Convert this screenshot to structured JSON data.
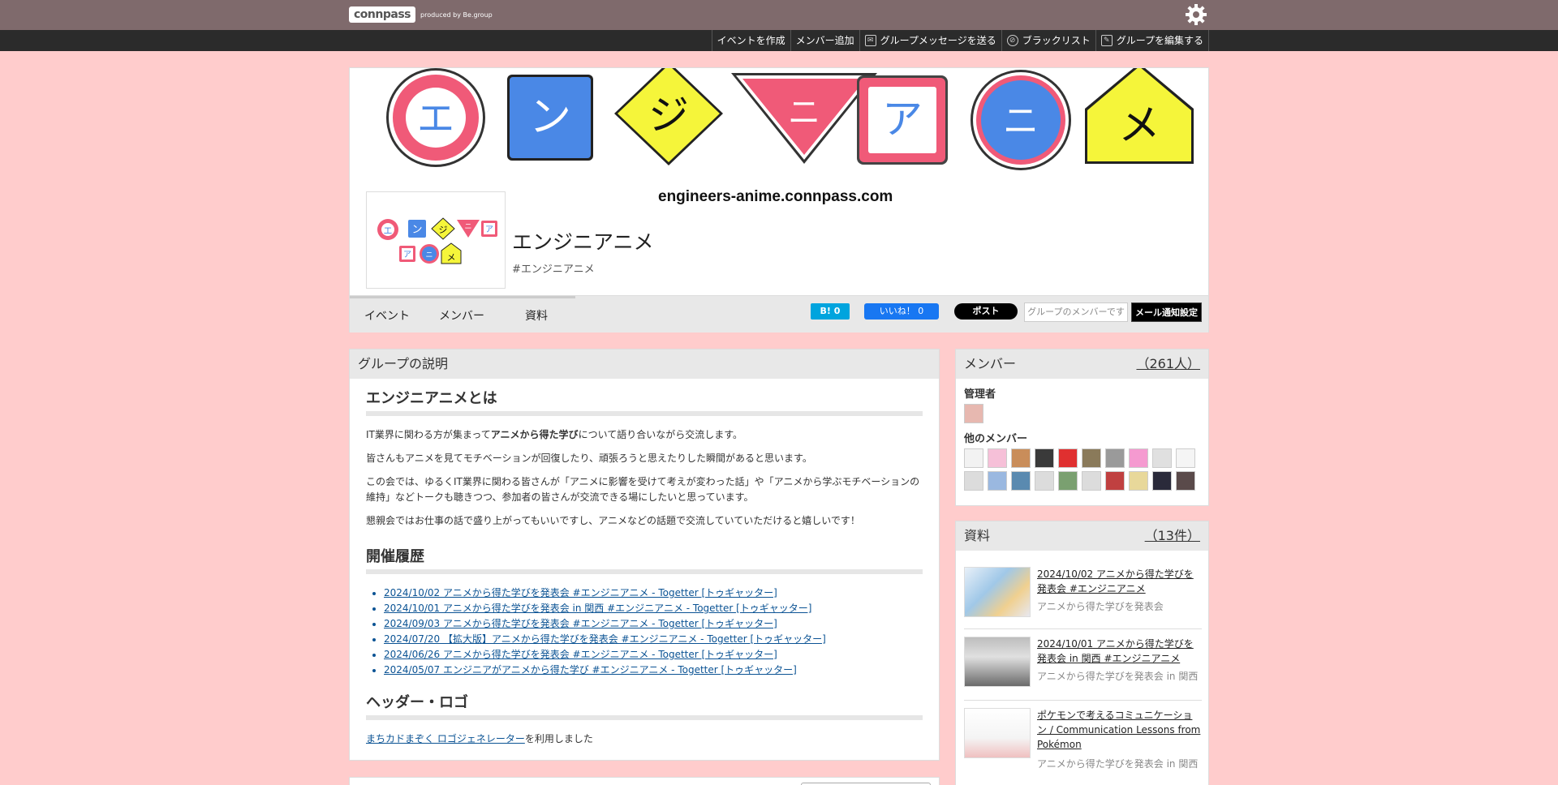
{
  "topbar": {
    "logo_text": "connpass",
    "logo_sub": "produced by Be.group"
  },
  "subnav": [
    {
      "label": "イベントを作成",
      "icon": ""
    },
    {
      "label": "メンバー追加",
      "icon": ""
    },
    {
      "label": "グループメッセージを送る",
      "icon": "mail-icon"
    },
    {
      "label": "ブラックリスト",
      "icon": "block-icon"
    },
    {
      "label": "グループを編集する",
      "icon": "edit-icon"
    }
  ],
  "banner": {
    "signs": [
      "エ",
      "ン",
      "ジ",
      "ニ",
      "ア",
      "ニ",
      "メ"
    ],
    "domain": "engineers-anime.connpass.com"
  },
  "group": {
    "title": "エンジニアニメ",
    "tag": "#エンジニアニメ"
  },
  "tabs": [
    "イベント",
    "メンバー",
    "資料"
  ],
  "social": {
    "hatena": "B! 0",
    "facebook": "いいね！ 0",
    "x": "ポスト",
    "member_status": "グループのメンバーです",
    "mail_setting": "メール通知設定"
  },
  "colors": {
    "page_bg": "#ffcccc",
    "topbar": "#7f6a6c",
    "sign_pink": "#f05a78",
    "sign_blue": "#4a88e6",
    "sign_yellow": "#f5f53a"
  },
  "description": {
    "header": "グループの説明",
    "section1_title": "エンジニアニメとは",
    "para1_a": "IT業界に関わる方が集まって",
    "para1_b": "アニメから得た学び",
    "para1_c": "について語り合いながら交流します。",
    "para2": "皆さんもアニメを見てモチベーションが回復したり、頑張ろうと思えたりした瞬間があると思います。",
    "para3": "この会では、ゆるくIT業界に関わる皆さんが「アニメに影響を受けて考えが変わった話」や「アニメから学ぶモチベーションの維持」などトークも聴きつつ、参加者の皆さんが交流できる場にしたいと思っています。",
    "para4": "懇親会ではお仕事の話で盛り上がってもいいですし、アニメなどの話題で交流していていただけると嬉しいです！",
    "section2_title": "開催履歴",
    "history": [
      "2024/10/02 アニメから得た学びを発表会 #エンジニアニメ - Togetter [トゥギャッター]",
      "2024/10/01 アニメから得た学びを発表会 in 関西 #エンジニアニメ - Togetter [トゥギャッター]",
      "2024/09/03 アニメから得た学びを発表会 #エンジニアニメ - Togetter [トゥギャッター]",
      "2024/07/20 【拡大版】アニメから得た学びを発表会 #エンジニアニメ - Togetter [トゥギャッター]",
      "2024/06/26 アニメから得た学びを発表会 #エンジニアニメ - Togetter [トゥギャッター]",
      "2024/05/07 エンジニアがアニメから得た学び #エンジニアニメ - Togetter [トゥギャッター]"
    ],
    "section3_title": "ヘッダー・ロゴ",
    "credit_link": "まちカドまぞく ロゴジェネレーター",
    "credit_rest": "を利用しました"
  },
  "members": {
    "header": "メンバー",
    "count": "（261人）",
    "admin_label": "管理者",
    "others_label": "他のメンバー"
  },
  "docs": {
    "header": "資料",
    "count": "（13件）",
    "items": [
      {
        "title": "2024/10/02 アニメから得た学びを発表会 #エンジニアニメ",
        "sub": "アニメから得た学びを発表会"
      },
      {
        "title": "2024/10/01 アニメから得た学びを発表会 in 関西 #エンジニアニメ",
        "sub": "アニメから得た学びを発表会 in 関西"
      },
      {
        "title": "ポケモンで考えるコミュニケーション / Communication Lessons from Pokémon",
        "sub": "アニメから得た学びを発表会 in 関西"
      }
    ]
  }
}
